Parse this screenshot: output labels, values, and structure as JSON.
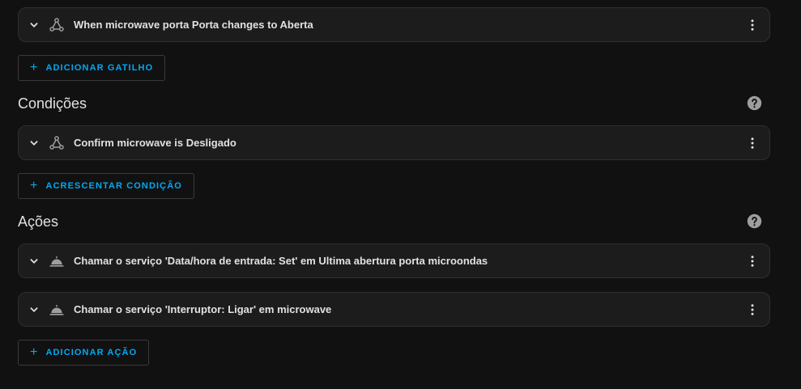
{
  "triggers": {
    "items": [
      {
        "label": "When microwave porta Porta changes to Aberta",
        "icon": "state-trigger-icon"
      }
    ],
    "add_label": "ADICIONAR GATILHO"
  },
  "conditions": {
    "title": "Condições",
    "items": [
      {
        "label": "Confirm microwave is Desligado",
        "icon": "state-condition-icon"
      }
    ],
    "add_label": "ACRESCENTAR CONDIÇÃO"
  },
  "actions": {
    "title": "Ações",
    "items": [
      {
        "label": "Chamar o serviço 'Data/hora de entrada: Set' em Ultima abertura porta microondas",
        "icon": "service-bell-icon"
      },
      {
        "label": "Chamar o serviço 'Interruptor: Ligar' em microwave",
        "icon": "service-bell-icon"
      }
    ],
    "add_label": "ADICIONAR AÇÃO"
  },
  "colors": {
    "accent": "#03a9f4",
    "card_bg": "#1c1c1c",
    "page_bg": "#111111"
  }
}
